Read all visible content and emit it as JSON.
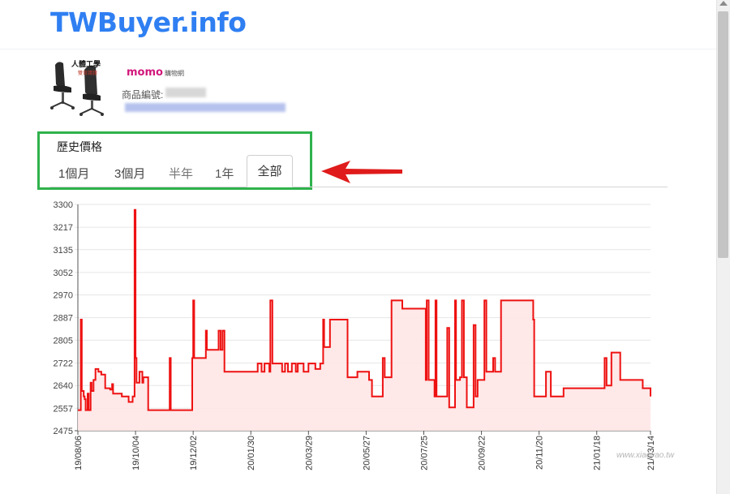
{
  "site": {
    "brand": "TWBuyer.info"
  },
  "product": {
    "image_caption_line1": "人體工學",
    "image_caption_line2": "雙背護腰",
    "store_logo": "momo",
    "store_logo_sub": "購物網",
    "id_label": "商品編號:"
  },
  "history": {
    "title": "歷史價格",
    "tabs": [
      "1個月",
      "3個月",
      "半年",
      "1年",
      "全部"
    ],
    "active_tab": "全部"
  },
  "colors": {
    "brand": "#2f7ff2",
    "line": "#ee1111",
    "highlight": "#2fb24c",
    "arrow": "#e01b1b",
    "store": "#d2177b"
  },
  "watermark": "www.xiaoyao.tw",
  "chart_data": {
    "type": "line",
    "title": "",
    "xlabel": "",
    "ylabel": "",
    "ylim": [
      2475,
      3300
    ],
    "y_ticks": [
      3300,
      3217,
      3135,
      3052,
      2970,
      2887,
      2805,
      2722,
      2640,
      2557,
      2475
    ],
    "x_ticks": [
      "19/08/06",
      "19/10/04",
      "19/12/02",
      "20/01/30",
      "20/03/29",
      "20/05/27",
      "20/07/25",
      "20/09/22",
      "20/11/20",
      "21/01/18",
      "21/03/14"
    ],
    "fill": true,
    "grid": "horizontal",
    "series": [
      {
        "points": [
          [
            "19/08/06",
            2550
          ],
          [
            "19/08/09",
            2880
          ],
          [
            "19/08/10",
            2620
          ],
          [
            "19/08/12",
            2600
          ],
          [
            "19/08/13",
            2590
          ],
          [
            "19/08/14",
            2550
          ],
          [
            "19/08/16",
            2610
          ],
          [
            "19/08/17",
            2550
          ],
          [
            "19/08/19",
            2650
          ],
          [
            "19/08/20",
            2620
          ],
          [
            "19/08/22",
            2660
          ],
          [
            "19/08/24",
            2700
          ],
          [
            "19/08/27",
            2690
          ],
          [
            "19/08/30",
            2680
          ],
          [
            "19/09/03",
            2630
          ],
          [
            "19/09/08",
            2625
          ],
          [
            "19/09/10",
            2645
          ],
          [
            "19/09/11",
            2610
          ],
          [
            "19/09/16",
            2610
          ],
          [
            "19/09/20",
            2600
          ],
          [
            "19/09/27",
            2580
          ],
          [
            "19/10/01",
            2600
          ],
          [
            "19/10/03",
            3280
          ],
          [
            "19/10/04",
            2740
          ],
          [
            "19/10/05",
            2650
          ],
          [
            "19/10/08",
            2690
          ],
          [
            "19/10/11",
            2650
          ],
          [
            "19/10/12",
            2670
          ],
          [
            "19/10/16",
            2670
          ],
          [
            "19/10/17",
            2550
          ],
          [
            "19/11/07",
            2550
          ],
          [
            "19/11/08",
            2740
          ],
          [
            "19/11/09",
            2550
          ],
          [
            "19/11/30",
            2550
          ],
          [
            "19/12/01",
            2740
          ],
          [
            "19/12/02",
            2950
          ],
          [
            "19/12/03",
            2740
          ],
          [
            "19/12/13",
            2740
          ],
          [
            "19/12/15",
            2840
          ],
          [
            "19/12/16",
            2770
          ],
          [
            "19/12/27",
            2770
          ],
          [
            "19/12/28",
            2840
          ],
          [
            "19/12/30",
            2770
          ],
          [
            "20/01/01",
            2840
          ],
          [
            "20/01/03",
            2690
          ],
          [
            "20/02/05",
            2690
          ],
          [
            "20/02/06",
            2720
          ],
          [
            "20/02/10",
            2690
          ],
          [
            "20/02/13",
            2720
          ],
          [
            "20/02/18",
            2690
          ],
          [
            "20/02/19",
            2950
          ],
          [
            "20/02/21",
            2720
          ],
          [
            "20/03/01",
            2720
          ],
          [
            "20/03/02",
            2690
          ],
          [
            "20/03/05",
            2720
          ],
          [
            "20/03/08",
            2690
          ],
          [
            "20/03/12",
            2720
          ],
          [
            "20/03/16",
            2690
          ],
          [
            "20/03/18",
            2720
          ],
          [
            "20/03/24",
            2690
          ],
          [
            "20/03/29",
            2720
          ],
          [
            "20/04/03",
            2720
          ],
          [
            "20/04/05",
            2700
          ],
          [
            "20/04/10",
            2720
          ],
          [
            "20/04/13",
            2880
          ],
          [
            "20/04/14",
            2780
          ],
          [
            "20/04/18",
            2780
          ],
          [
            "20/04/20",
            2880
          ],
          [
            "20/05/07",
            2880
          ],
          [
            "20/05/08",
            2670
          ],
          [
            "20/05/17",
            2670
          ],
          [
            "20/05/18",
            2690
          ],
          [
            "20/05/29",
            2690
          ],
          [
            "20/05/30",
            2660
          ],
          [
            "20/06/02",
            2600
          ],
          [
            "20/06/12",
            2600
          ],
          [
            "20/06/13",
            2740
          ],
          [
            "20/06/15",
            2670
          ],
          [
            "20/06/20",
            2670
          ],
          [
            "20/06/22",
            2950
          ],
          [
            "20/07/02",
            2950
          ],
          [
            "20/07/03",
            2920
          ],
          [
            "20/07/25",
            2920
          ],
          [
            "20/07/27",
            2660
          ],
          [
            "20/07/28",
            2950
          ],
          [
            "20/07/30",
            2660
          ],
          [
            "20/08/05",
            2600
          ],
          [
            "20/08/06",
            2950
          ],
          [
            "20/08/07",
            2600
          ],
          [
            "20/08/17",
            2600
          ],
          [
            "20/08/18",
            2850
          ],
          [
            "20/08/20",
            2560
          ],
          [
            "20/08/25",
            2560
          ],
          [
            "20/08/26",
            2950
          ],
          [
            "20/08/27",
            2660
          ],
          [
            "20/08/31",
            2670
          ],
          [
            "20/09/02",
            2950
          ],
          [
            "20/09/04",
            2670
          ],
          [
            "20/09/07",
            2560
          ],
          [
            "20/09/12",
            2560
          ],
          [
            "20/09/14",
            2860
          ],
          [
            "20/09/16",
            2600
          ],
          [
            "20/09/18",
            2660
          ],
          [
            "20/09/22",
            2660
          ],
          [
            "20/09/25",
            2950
          ],
          [
            "20/09/27",
            2690
          ],
          [
            "20/10/03",
            2690
          ],
          [
            "20/10/04",
            2740
          ],
          [
            "20/10/06",
            2690
          ],
          [
            "20/10/11",
            2690
          ],
          [
            "20/10/12",
            2950
          ],
          [
            "20/11/14",
            2880
          ],
          [
            "20/11/15",
            2600
          ],
          [
            "20/11/26",
            2600
          ],
          [
            "20/11/27",
            2690
          ],
          [
            "20/12/01",
            2690
          ],
          [
            "20/12/02",
            2600
          ],
          [
            "20/12/14",
            2600
          ],
          [
            "20/12/15",
            2630
          ],
          [
            "21/01/25",
            2630
          ],
          [
            "21/01/26",
            2740
          ],
          [
            "21/01/28",
            2640
          ],
          [
            "21/02/02",
            2760
          ],
          [
            "21/02/10",
            2760
          ],
          [
            "21/02/11",
            2660
          ],
          [
            "21/03/03",
            2660
          ],
          [
            "21/03/06",
            2630
          ],
          [
            "21/03/13",
            2630
          ],
          [
            "21/03/14",
            2600
          ]
        ]
      }
    ]
  }
}
